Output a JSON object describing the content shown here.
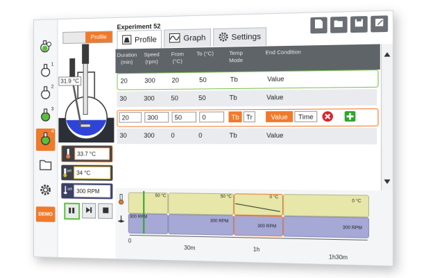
{
  "window": {
    "experiment_title": "Experiment 52"
  },
  "sidebar": {
    "reactors": [
      {
        "num": "",
        "active": false
      },
      {
        "num": "1",
        "active": false
      },
      {
        "num": "2",
        "active": false
      },
      {
        "num": "3",
        "active": false
      },
      {
        "num": "4",
        "active": true
      }
    ],
    "demo_label": "DEMO"
  },
  "reactor_panel": {
    "profile_toggle_label": "Profile",
    "probe_temp": "31.9 °C",
    "readings": {
      "temperature": "33.7 °C",
      "set_temp_label": "set",
      "set_temperature": "34 °C",
      "set_speed_label": "set",
      "set_speed": "300 RPM"
    }
  },
  "tabs": [
    {
      "label": "Profile",
      "active": true
    },
    {
      "label": "Graph",
      "active": false
    },
    {
      "label": "Settings",
      "active": false
    }
  ],
  "table": {
    "headers": [
      "Duration (min)",
      "Speed (rpm)",
      "From (°C)",
      "To (°C)",
      "Temp Mode",
      "End Condition"
    ],
    "rows": [
      {
        "duration": "20",
        "speed": "300",
        "from": "20",
        "to": "50",
        "mode": "Tb",
        "end": "Value"
      },
      {
        "duration": "30",
        "speed": "300",
        "from": "50",
        "to": "50",
        "mode": "Tb",
        "end": "Value"
      },
      {
        "duration": "20",
        "speed": "300",
        "from": "50",
        "to": "0",
        "mode_options": [
          "Tb",
          "Tr"
        ],
        "end_options": [
          "Value",
          "Time"
        ]
      },
      {
        "duration": "30",
        "speed": "300",
        "from": "0",
        "to": "0",
        "mode": "Tb",
        "end": "Value"
      }
    ]
  },
  "graph": {
    "temp_labels": [
      "50 °C",
      "50 °C",
      "0 °C",
      "0 °C"
    ],
    "speed_labels": [
      "300 RPM",
      "300 RPM",
      "300 RPM",
      "300 RPM"
    ],
    "time_ticks": [
      "0",
      "30m",
      "1h",
      "1h30m"
    ]
  },
  "colors": {
    "accent": "#f07a2a",
    "green": "#5bbf3a",
    "header": "#5f6469"
  }
}
